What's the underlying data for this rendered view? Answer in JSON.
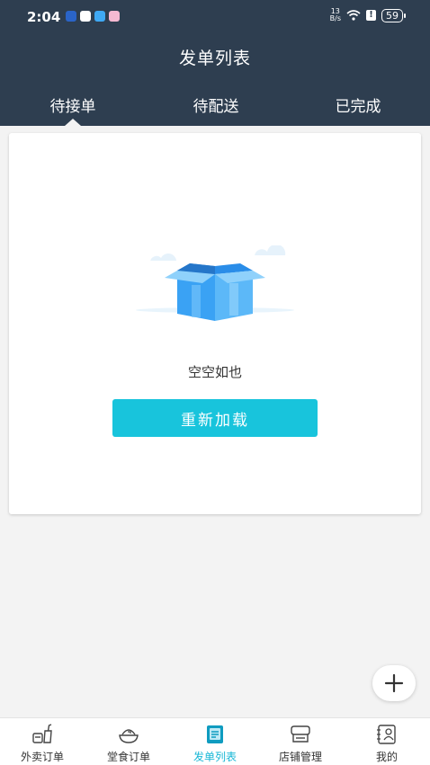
{
  "status_bar": {
    "time": "2:04",
    "net_speed_top": "13",
    "net_speed_bottom": "B/s",
    "battery": "59",
    "alert": "!"
  },
  "header": {
    "title": "发单列表",
    "tabs": [
      {
        "label": "待接单",
        "active": true
      },
      {
        "label": "待配送",
        "active": false
      },
      {
        "label": "已完成",
        "active": false
      }
    ]
  },
  "empty_state": {
    "message": "空空如也",
    "reload_label": "重新加载"
  },
  "fab": {
    "icon": "plus-icon"
  },
  "bottom_nav": {
    "items": [
      {
        "label": "外卖订单",
        "icon": "takeout-icon",
        "active": false
      },
      {
        "label": "堂食订单",
        "icon": "dine-in-icon",
        "active": false
      },
      {
        "label": "发单列表",
        "icon": "dispatch-list-icon",
        "active": true
      },
      {
        "label": "店铺管理",
        "icon": "store-icon",
        "active": false
      },
      {
        "label": "我的",
        "icon": "profile-icon",
        "active": false
      }
    ]
  },
  "colors": {
    "header_bg": "#2e3e50",
    "accent": "#18c4dc",
    "active_nav": "#18b7d6"
  }
}
